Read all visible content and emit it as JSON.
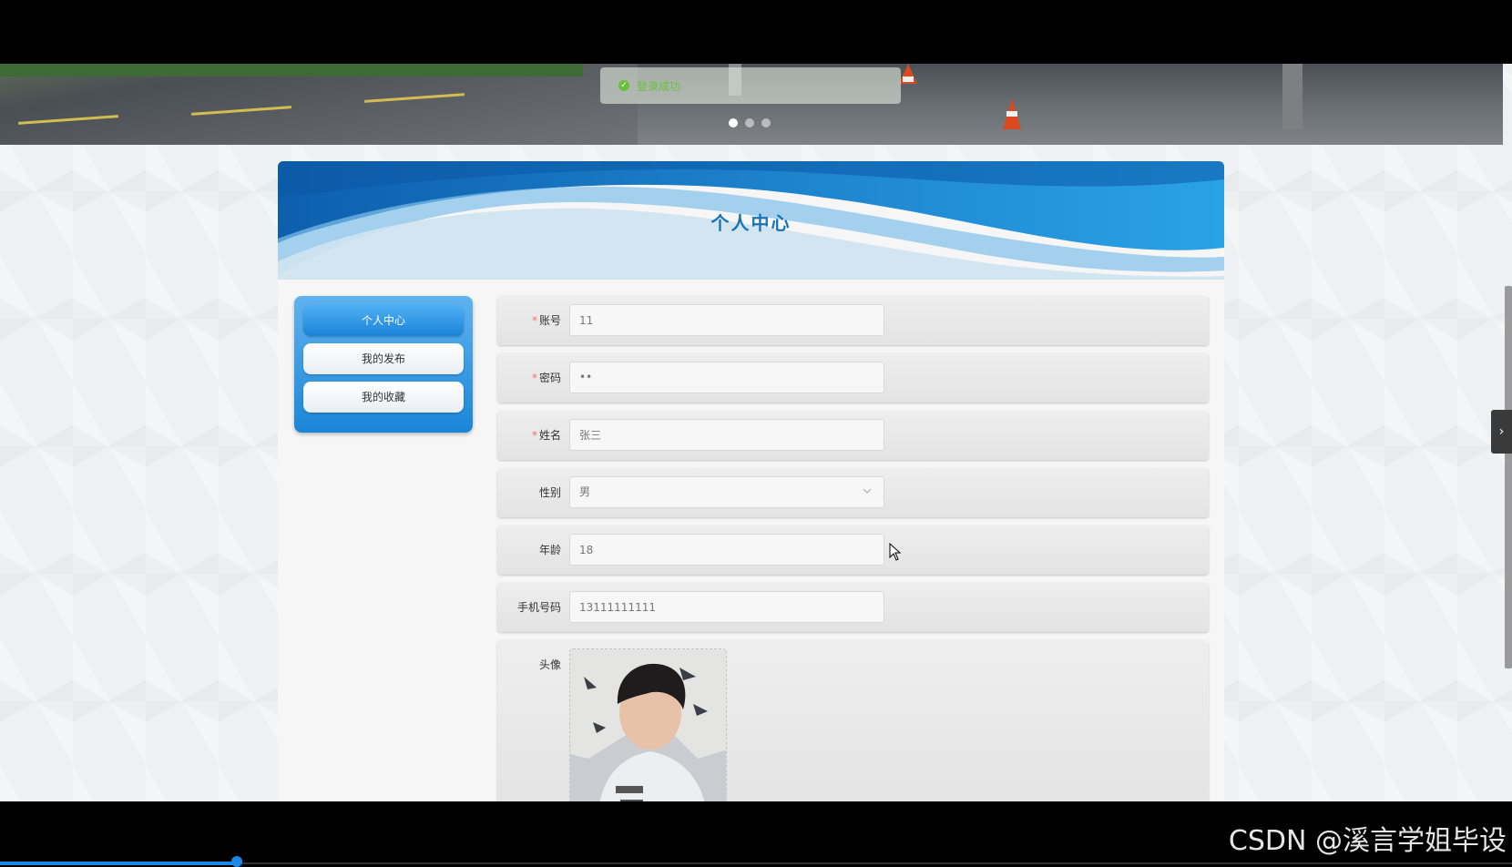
{
  "toast": {
    "message": "登录成功"
  },
  "carousel": {
    "dot_count": 3,
    "active_index": 0
  },
  "page": {
    "title": "个人中心"
  },
  "menu": {
    "items": [
      {
        "label": "个人中心",
        "active": true
      },
      {
        "label": "我的发布",
        "active": false
      },
      {
        "label": "我的收藏",
        "active": false
      }
    ]
  },
  "form": {
    "account": {
      "label": "账号",
      "required": true,
      "value": "11"
    },
    "password": {
      "label": "密码",
      "required": true,
      "value": "••"
    },
    "name": {
      "label": "姓名",
      "required": true,
      "value": "张三"
    },
    "gender": {
      "label": "性别",
      "required": false,
      "value": "男"
    },
    "age": {
      "label": "年龄",
      "required": false,
      "value": "18"
    },
    "phone": {
      "label": "手机号码",
      "required": false,
      "value": "13111111111"
    },
    "avatar": {
      "label": "头像",
      "required": false
    }
  },
  "required_mark": "*",
  "watermark": "CSDN @溪言学姐毕设",
  "colors": {
    "accent": "#1b83d6",
    "title": "#1673b8",
    "required": "#f56c6c",
    "success": "#67c23a"
  }
}
